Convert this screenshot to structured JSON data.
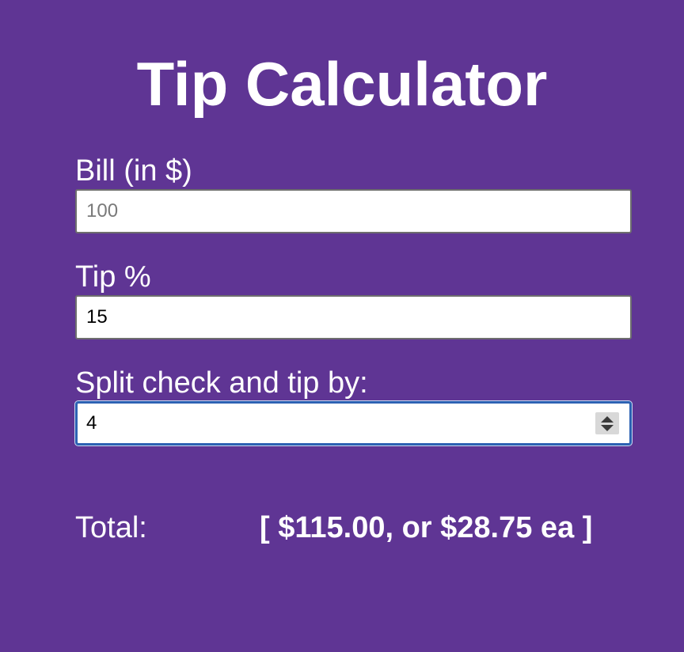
{
  "app": {
    "title": "Tip Calculator"
  },
  "form": {
    "bill": {
      "label": "Bill (in $)",
      "placeholder": "100",
      "value": ""
    },
    "tip": {
      "label": "Tip %",
      "value": "15"
    },
    "split": {
      "label": "Split check and tip by:",
      "value": "4"
    }
  },
  "result": {
    "label": "Total:",
    "value": "[ $115.00, or $28.75 ea ]"
  },
  "colors": {
    "background": "#5f3594",
    "text": "#ffffff",
    "focus_border": "#2d62b3"
  }
}
